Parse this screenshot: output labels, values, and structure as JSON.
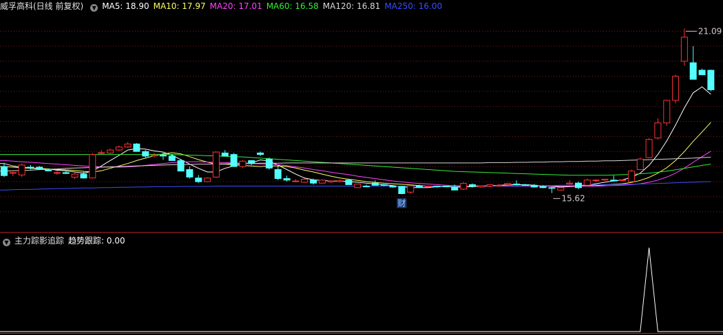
{
  "header": {
    "title": "威孚高科(日线 前复权)",
    "ma5": "MA5: 18.90",
    "ma10": "MA10: 17.97",
    "ma20": "MA20: 17.01",
    "ma60": "MA60: 16.58",
    "ma120": "MA120: 16.81",
    "ma250": "MA250: 16.00"
  },
  "indicator": {
    "name": "主力踪影追踪",
    "trend_label": "趋势跟踪: 0.00"
  },
  "colors": {
    "up": "#ff3232",
    "down": "#54ffff",
    "ma5": "#ffffff",
    "ma10": "#ffff66",
    "ma20": "#ff44ff",
    "ma60": "#33ee33",
    "ma120": "#d8d8d8",
    "ma250": "#3a4dff",
    "grid": "#8a1a1a",
    "divider": "#c02828",
    "indicator_line": "#ffffff"
  },
  "chart_data": [
    {
      "type": "candlestick",
      "title": "威孚高科(日线 前复权)",
      "ylim": [
        14.4,
        21.6
      ],
      "grid": true,
      "ohlc": [
        [
          16.5,
          16.62,
          16.15,
          16.2
        ],
        [
          16.3,
          16.32,
          16.18,
          16.3
        ],
        [
          16.22,
          16.6,
          16.15,
          16.55
        ],
        [
          16.48,
          16.55,
          16.4,
          16.45
        ],
        [
          16.48,
          16.52,
          16.38,
          16.4
        ],
        [
          16.38,
          16.42,
          16.34,
          16.36
        ],
        [
          16.3,
          16.36,
          16.22,
          16.3
        ],
        [
          16.3,
          16.35,
          16.25,
          16.27
        ],
        [
          16.15,
          16.3,
          16.08,
          16.25
        ],
        [
          16.25,
          16.35,
          16.1,
          16.12
        ],
        [
          16.12,
          16.95,
          16.1,
          16.9
        ],
        [
          16.95,
          17.05,
          16.9,
          16.96
        ],
        [
          16.95,
          17.1,
          16.92,
          17.05
        ],
        [
          17.05,
          17.2,
          17.02,
          17.15
        ],
        [
          17.15,
          17.32,
          17.12,
          17.25
        ],
        [
          17.25,
          17.28,
          17.0,
          17.0
        ],
        [
          17.0,
          17.05,
          16.8,
          16.85
        ],
        [
          16.85,
          16.95,
          16.8,
          16.88
        ],
        [
          16.88,
          16.95,
          16.72,
          16.85
        ],
        [
          16.85,
          16.92,
          16.7,
          16.7
        ],
        [
          16.7,
          16.75,
          16.35,
          16.35
        ],
        [
          16.4,
          16.5,
          16.1,
          16.15
        ],
        [
          16.12,
          16.22,
          15.96,
          16.0
        ],
        [
          16.0,
          16.14,
          15.98,
          16.12
        ],
        [
          16.15,
          17.0,
          16.12,
          16.98
        ],
        [
          16.95,
          17.05,
          16.85,
          16.85
        ],
        [
          16.9,
          16.95,
          16.5,
          16.5
        ],
        [
          16.5,
          16.72,
          16.45,
          16.68
        ],
        [
          16.7,
          16.7,
          16.55,
          16.6
        ],
        [
          16.95,
          17.0,
          16.85,
          16.9
        ],
        [
          16.75,
          16.8,
          16.4,
          16.45
        ],
        [
          16.4,
          16.52,
          16.05,
          16.1
        ],
        [
          16.1,
          16.2,
          16.0,
          16.05
        ],
        [
          16.0,
          16.08,
          15.98,
          16.02
        ],
        [
          15.98,
          16.1,
          15.96,
          16.08
        ],
        [
          16.05,
          16.1,
          15.9,
          15.95
        ],
        [
          15.95,
          16.08,
          15.93,
          16.05
        ],
        [
          15.99,
          16.04,
          15.96,
          16.02
        ],
        [
          16.0,
          16.06,
          15.97,
          16.03
        ],
        [
          16.05,
          16.08,
          15.9,
          15.9
        ],
        [
          15.8,
          15.92,
          15.78,
          15.92
        ],
        [
          15.85,
          15.9,
          15.82,
          15.84
        ],
        [
          15.95,
          16.04,
          15.88,
          15.88
        ],
        [
          15.9,
          15.92,
          15.85,
          15.88
        ],
        [
          15.85,
          15.88,
          15.8,
          15.82
        ],
        [
          15.84,
          15.86,
          15.58,
          15.6
        ],
        [
          15.65,
          15.88,
          15.6,
          15.86
        ],
        [
          15.85,
          15.9,
          15.8,
          15.84
        ],
        [
          15.85,
          15.87,
          15.83,
          15.85
        ],
        [
          15.85,
          15.86,
          15.8,
          15.83
        ],
        [
          15.85,
          15.86,
          15.82,
          15.84
        ],
        [
          15.82,
          15.9,
          15.72,
          15.72
        ],
        [
          15.75,
          15.98,
          15.72,
          15.94
        ],
        [
          15.9,
          15.94,
          15.8,
          15.84
        ],
        [
          15.82,
          15.87,
          15.8,
          15.86
        ],
        [
          15.85,
          15.92,
          15.82,
          15.9
        ],
        [
          15.88,
          15.92,
          15.84,
          15.88
        ],
        [
          15.9,
          15.96,
          15.88,
          15.94
        ],
        [
          15.92,
          16.04,
          15.88,
          15.9
        ],
        [
          15.9,
          15.92,
          15.86,
          15.88
        ],
        [
          15.88,
          15.92,
          15.8,
          15.82
        ],
        [
          15.84,
          15.88,
          15.78,
          15.8
        ],
        [
          15.8,
          15.82,
          15.62,
          15.78
        ],
        [
          15.72,
          15.82,
          15.7,
          15.8
        ],
        [
          15.92,
          16.05,
          15.9,
          15.95
        ],
        [
          15.95,
          16.0,
          15.75,
          15.8
        ],
        [
          15.88,
          16.1,
          15.85,
          16.05
        ],
        [
          16.05,
          16.08,
          15.98,
          16.05
        ],
        [
          16.05,
          16.09,
          16.02,
          16.08
        ],
        [
          16.05,
          16.2,
          16.0,
          16.02
        ],
        [
          16.05,
          16.08,
          16.02,
          16.06
        ],
        [
          16.0,
          16.4,
          15.98,
          16.35
        ],
        [
          16.4,
          16.8,
          16.38,
          16.75
        ],
        [
          16.8,
          17.45,
          16.78,
          17.4
        ],
        [
          17.45,
          18.1,
          17.4,
          17.95
        ],
        [
          17.95,
          18.72,
          17.85,
          18.7
        ],
        [
          18.7,
          19.55,
          18.6,
          19.5
        ],
        [
          20.0,
          21.09,
          19.85,
          20.8
        ],
        [
          19.95,
          20.5,
          19.4,
          19.4
        ],
        [
          19.7,
          19.75,
          19.55,
          19.55
        ],
        [
          19.7,
          19.72,
          19.0,
          19.05
        ]
      ],
      "series": [
        {
          "name": "MA5: 18.90",
          "values": [
            16.6,
            16.52,
            16.48,
            16.45,
            16.44,
            16.42,
            16.38,
            16.36,
            16.32,
            16.28,
            16.35,
            16.52,
            16.7,
            16.87,
            17.05,
            17.1,
            17.08,
            17.02,
            16.98,
            16.88,
            16.73,
            16.58,
            16.44,
            16.32,
            16.32,
            16.44,
            16.52,
            16.6,
            16.62,
            16.72,
            16.68,
            16.55,
            16.4,
            16.25,
            16.12,
            16.06,
            16.04,
            16.02,
            16.02,
            16.0,
            15.98,
            15.95,
            15.92,
            15.9,
            15.87,
            15.83,
            15.8,
            15.8,
            15.8,
            15.83,
            15.84,
            15.82,
            15.84,
            15.86,
            15.86,
            15.86,
            15.88,
            15.89,
            15.9,
            15.9,
            15.88,
            15.86,
            15.84,
            15.82,
            15.83,
            15.85,
            15.88,
            15.93,
            15.98,
            16.02,
            16.06,
            16.14,
            16.28,
            16.54,
            16.9,
            17.35,
            17.88,
            18.45,
            18.95,
            19.15,
            18.9
          ]
        },
        {
          "name": "MA10: 17.97",
          "values": [
            16.5,
            16.48,
            16.46,
            16.44,
            16.43,
            16.42,
            16.4,
            16.39,
            16.37,
            16.34,
            16.32,
            16.36,
            16.44,
            16.52,
            16.6,
            16.7,
            16.78,
            16.86,
            16.92,
            16.96,
            16.92,
            16.83,
            16.73,
            16.65,
            16.58,
            16.58,
            16.56,
            16.54,
            16.52,
            16.5,
            16.52,
            16.52,
            16.5,
            16.45,
            16.38,
            16.32,
            16.25,
            16.18,
            16.12,
            16.08,
            16.04,
            16.0,
            15.97,
            15.95,
            15.93,
            15.91,
            15.89,
            15.87,
            15.85,
            15.84,
            15.83,
            15.82,
            15.82,
            15.83,
            15.84,
            15.85,
            15.86,
            15.86,
            15.86,
            15.86,
            15.86,
            15.86,
            15.86,
            15.85,
            15.85,
            15.85,
            15.86,
            15.87,
            15.89,
            15.91,
            15.93,
            15.97,
            16.04,
            16.14,
            16.28,
            16.46,
            16.7,
            17.0,
            17.34,
            17.65,
            17.97
          ]
        },
        {
          "name": "MA20: 17.01",
          "values": [
            16.7,
            16.68,
            16.66,
            16.64,
            16.62,
            16.6,
            16.58,
            16.56,
            16.54,
            16.52,
            16.5,
            16.49,
            16.48,
            16.48,
            16.49,
            16.51,
            16.54,
            16.57,
            16.6,
            16.63,
            16.65,
            16.66,
            16.66,
            16.65,
            16.64,
            16.63,
            16.62,
            16.61,
            16.6,
            16.59,
            16.58,
            16.56,
            16.53,
            16.49,
            16.45,
            16.4,
            16.36,
            16.31,
            16.27,
            16.23,
            16.18,
            16.14,
            16.1,
            16.06,
            16.02,
            15.99,
            15.96,
            15.94,
            15.92,
            15.9,
            15.88,
            15.87,
            15.86,
            15.85,
            15.85,
            15.85,
            15.85,
            15.85,
            15.85,
            15.85,
            15.85,
            15.85,
            15.85,
            15.85,
            15.85,
            15.85,
            15.85,
            15.85,
            15.86,
            15.87,
            15.88,
            15.9,
            15.93,
            15.98,
            16.05,
            16.15,
            16.28,
            16.45,
            16.64,
            16.83,
            17.01
          ]
        },
        {
          "name": "MA60: 16.58",
          "values": [
            16.9,
            16.9,
            16.9,
            16.9,
            16.9,
            16.9,
            16.9,
            16.9,
            16.9,
            16.9,
            16.9,
            16.9,
            16.9,
            16.9,
            16.9,
            16.9,
            16.9,
            16.9,
            16.9,
            16.9,
            16.89,
            16.88,
            16.87,
            16.86,
            16.85,
            16.84,
            16.83,
            16.82,
            16.8,
            16.78,
            16.76,
            16.74,
            16.72,
            16.7,
            16.68,
            16.66,
            16.64,
            16.62,
            16.6,
            16.58,
            16.56,
            16.54,
            16.52,
            16.5,
            16.48,
            16.46,
            16.44,
            16.42,
            16.4,
            16.38,
            16.36,
            16.34,
            16.33,
            16.32,
            16.31,
            16.3,
            16.29,
            16.28,
            16.27,
            16.26,
            16.25,
            16.24,
            16.23,
            16.22,
            16.21,
            16.21,
            16.21,
            16.21,
            16.21,
            16.22,
            16.23,
            16.24,
            16.26,
            16.28,
            16.31,
            16.35,
            16.39,
            16.44,
            16.49,
            16.54,
            16.58
          ]
        },
        {
          "name": "MA120: 16.81",
          "values": [
            16.35,
            16.36,
            16.37,
            16.38,
            16.4,
            16.41,
            16.42,
            16.44,
            16.45,
            16.46,
            16.47,
            16.48,
            16.49,
            16.5,
            16.51,
            16.52,
            16.53,
            16.54,
            16.55,
            16.56,
            16.57,
            16.57,
            16.58,
            16.58,
            16.59,
            16.59,
            16.6,
            16.6,
            16.6,
            16.61,
            16.61,
            16.61,
            16.62,
            16.62,
            16.62,
            16.62,
            16.62,
            16.62,
            16.62,
            16.62,
            16.62,
            16.62,
            16.62,
            16.62,
            16.62,
            16.62,
            16.62,
            16.62,
            16.62,
            16.62,
            16.62,
            16.62,
            16.62,
            16.62,
            16.62,
            16.63,
            16.63,
            16.63,
            16.64,
            16.64,
            16.65,
            16.65,
            16.66,
            16.66,
            16.67,
            16.67,
            16.68,
            16.68,
            16.69,
            16.69,
            16.7,
            16.71,
            16.72,
            16.73,
            16.74,
            16.75,
            16.76,
            16.77,
            16.78,
            16.8,
            16.81
          ]
        },
        {
          "name": "MA250: 16.00",
          "values": [
            15.72,
            15.73,
            15.74,
            15.74,
            15.75,
            15.76,
            15.77,
            15.77,
            15.78,
            15.79,
            15.79,
            15.8,
            15.8,
            15.81,
            15.81,
            15.82,
            15.82,
            15.83,
            15.83,
            15.83,
            15.84,
            15.84,
            15.84,
            15.84,
            15.85,
            15.85,
            15.85,
            15.85,
            15.85,
            15.85,
            15.85,
            15.85,
            15.85,
            15.85,
            15.85,
            15.85,
            15.85,
            15.85,
            15.85,
            15.85,
            15.85,
            15.85,
            15.85,
            15.85,
            15.85,
            15.85,
            15.85,
            15.85,
            15.85,
            15.85,
            15.85,
            15.85,
            15.85,
            15.85,
            15.85,
            15.85,
            15.86,
            15.86,
            15.86,
            15.86,
            15.87,
            15.87,
            15.87,
            15.88,
            15.88,
            15.88,
            15.89,
            15.89,
            15.9,
            15.9,
            15.91,
            15.91,
            15.92,
            15.93,
            15.94,
            15.95,
            15.96,
            15.97,
            15.98,
            15.99,
            16.0
          ]
        }
      ],
      "annotations": [
        {
          "text": "21.09",
          "candle": 77,
          "at": "high"
        },
        {
          "text": "15.62",
          "candle": 62,
          "at": "low"
        },
        {
          "text": "财",
          "candle": 45,
          "at": "low"
        }
      ]
    },
    {
      "type": "line",
      "title": "主力踪影追踪",
      "ylim": [
        0,
        1
      ],
      "series": [
        {
          "name": "趋势跟踪: 0.00",
          "values": [
            0,
            0,
            0,
            0,
            0,
            0,
            0,
            0,
            0,
            0,
            0,
            0,
            0,
            0,
            0,
            0,
            0,
            0,
            0,
            0,
            0,
            0,
            0,
            0,
            0,
            0,
            0,
            0,
            0,
            0,
            0,
            0,
            0,
            0,
            0,
            0,
            0,
            0,
            0,
            0,
            0,
            0,
            0,
            0,
            0,
            0,
            0,
            0,
            0,
            0,
            0,
            0,
            0,
            0,
            0,
            0,
            0,
            0,
            0,
            0,
            0,
            0,
            0,
            0,
            0,
            0,
            0,
            0,
            0,
            0,
            0,
            0,
            0,
            1,
            0,
            0,
            0,
            0,
            0,
            0,
            0
          ]
        }
      ]
    }
  ]
}
